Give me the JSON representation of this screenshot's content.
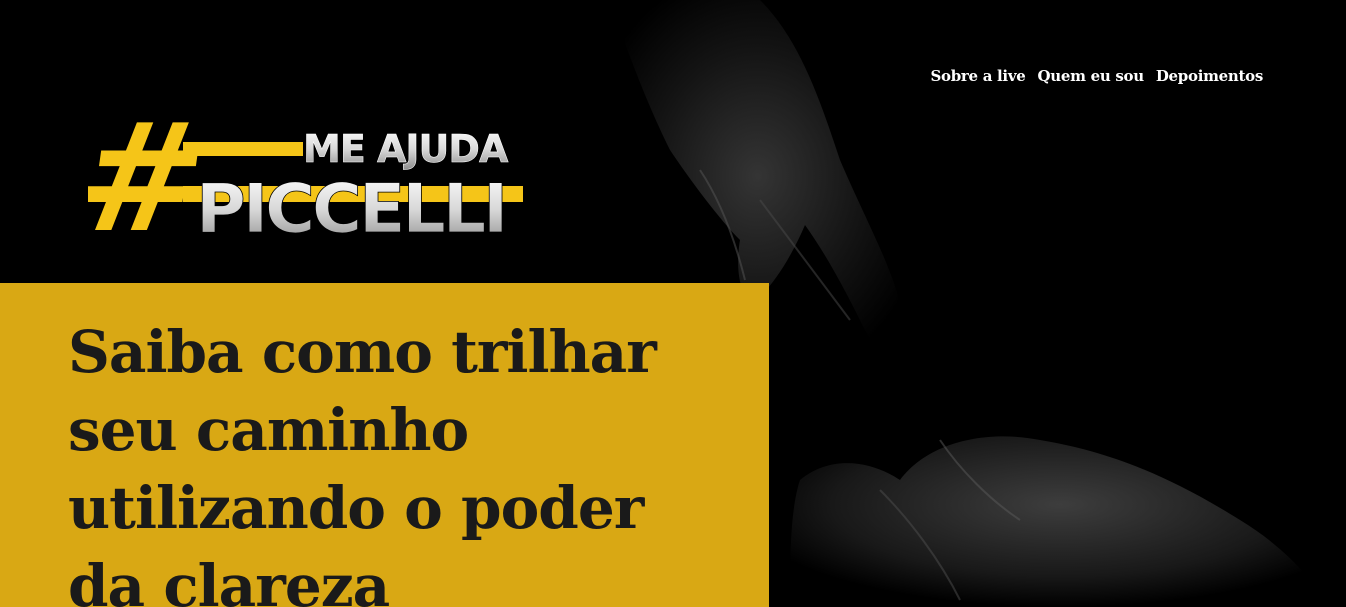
{
  "nav": {
    "items": [
      {
        "label": "Sobre a live"
      },
      {
        "label": "Quem eu sou"
      },
      {
        "label": "Depoimentos"
      }
    ]
  },
  "logo": {
    "hash": "#",
    "line1": "ME AJUDA",
    "line2": "PICCELLI",
    "accent_color": "#f5c518"
  },
  "hero": {
    "headline": "Saiba como trilhar seu caminho utilizando o poder da clareza",
    "box_color": "#d9a814"
  }
}
